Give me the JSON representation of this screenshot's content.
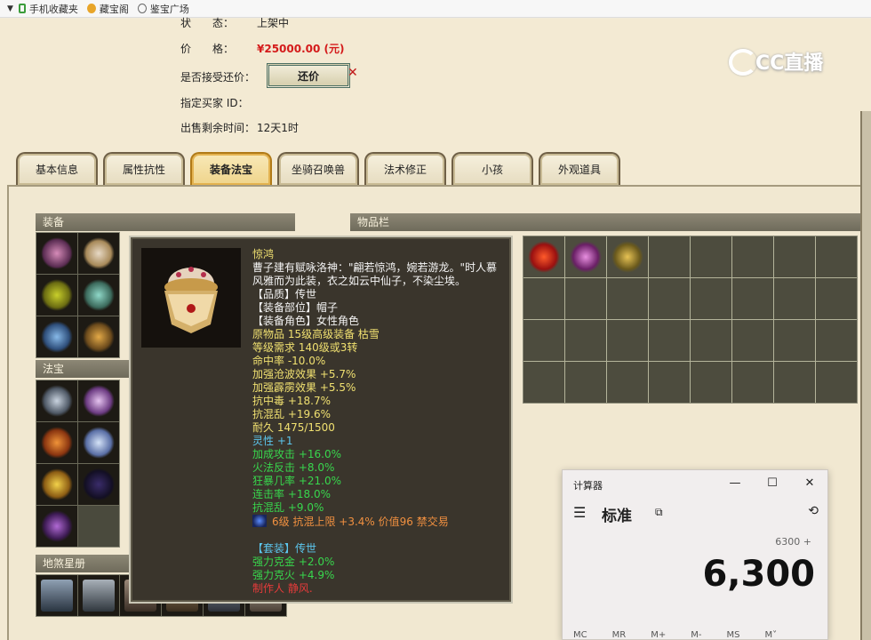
{
  "bookmarks": {
    "items": [
      {
        "label": "手机收藏夹",
        "icon": "phone-icon"
      },
      {
        "label": "藏宝阁",
        "icon": "treasure-icon"
      },
      {
        "label": "鉴宝广场",
        "icon": "globe-icon"
      }
    ]
  },
  "brand": {
    "logo_text": "CC直播"
  },
  "listing": {
    "status_label": "状　　态：",
    "status_value": "上架中",
    "price_label": "价　　格：",
    "price_value": "¥25000.00 (元)",
    "counter_label": "是否接受还价：",
    "counter_button": "还价",
    "buyer_label": "指定买家 ID：",
    "buyer_value": "",
    "time_label": "出售剩余时间：",
    "time_value": "12天1时"
  },
  "tabs": [
    {
      "label": "基本信息",
      "active": false
    },
    {
      "label": "属性抗性",
      "active": false
    },
    {
      "label": "装备法宝",
      "active": true
    },
    {
      "label": "坐骑召唤兽",
      "active": false
    },
    {
      "label": "法术修正",
      "active": false
    },
    {
      "label": "小孩",
      "active": false
    },
    {
      "label": "外观道具",
      "active": false
    }
  ],
  "panels": {
    "equipment_title": "装备",
    "artifact_title": "法宝",
    "star_title": "地煞星册",
    "inventory_title": "物品栏"
  },
  "tooltip": {
    "name": "惊鸿",
    "description": "曹子建有赋咏洛神：\"翩若惊鸿，婉若游龙。\"时人慕风雅而为此装，衣之如云中仙子，不染尘埃。",
    "lines": [
      {
        "text": "【品质】传世",
        "color": "white"
      },
      {
        "text": "【装备部位】帽子",
        "color": "white"
      },
      {
        "text": "【装备角色】女性角色",
        "color": "white"
      },
      {
        "text": "原物品 15级高级装备 枯雪",
        "color": "yellow"
      },
      {
        "text": "等级需求 140级或3转",
        "color": "yellow"
      },
      {
        "text": "命中率 -10.0%",
        "color": "yellow"
      },
      {
        "text": "加强沧波效果 +5.7%",
        "color": "yellow"
      },
      {
        "text": "加强霹雳效果 +5.5%",
        "color": "yellow"
      },
      {
        "text": "抗中毒 +18.7%",
        "color": "yellow"
      },
      {
        "text": "抗混乱 +19.6%",
        "color": "yellow"
      },
      {
        "text": "耐久 1475/1500",
        "color": "yellow"
      },
      {
        "text": "灵性 +1",
        "color": "cyan"
      },
      {
        "text": "加成攻击 +16.0%",
        "color": "green"
      },
      {
        "text": "火法反击 +8.0%",
        "color": "green"
      },
      {
        "text": "狂暴几率 +21.0%",
        "color": "green"
      },
      {
        "text": "连击率 +18.0%",
        "color": "green"
      },
      {
        "text": "抗混乱 +9.0%",
        "color": "green"
      },
      {
        "text": "6级 抗混上限 +3.4% 价值96 禁交易",
        "color": "orange",
        "gem": true
      },
      {
        "text": "",
        "color": "yellow"
      },
      {
        "text": "【套装】传世",
        "color": "cyan"
      },
      {
        "text": "强力克金 +2.0%",
        "color": "green"
      },
      {
        "text": "强力克火 +4.9%",
        "color": "green"
      },
      {
        "text": "制作人 静风.",
        "color": "red"
      }
    ]
  },
  "calculator": {
    "title": "计算器",
    "mode": "标准",
    "expression": "6300 +",
    "result": "6,300",
    "memory": [
      "MC",
      "MR",
      "M+",
      "M-",
      "MS",
      "M˅"
    ]
  }
}
